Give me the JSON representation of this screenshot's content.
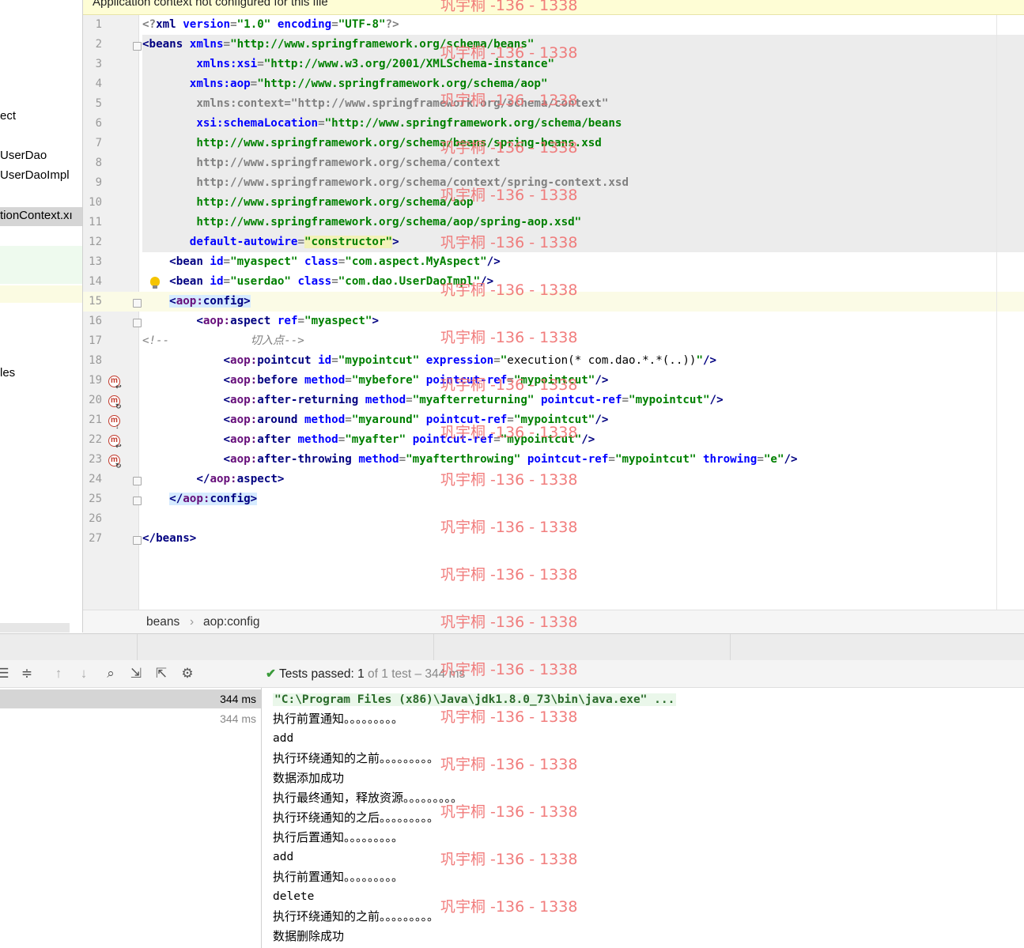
{
  "left_panel": {
    "items": [
      {
        "label": "ect"
      },
      {
        "label": "UserDao"
      },
      {
        "label": "UserDaoImpl"
      },
      {
        "label": "tionContext.xı"
      },
      {
        "label": "les"
      }
    ]
  },
  "editor": {
    "banner": "Application context not configured for this file",
    "line_numbers": [
      "1",
      "2",
      "3",
      "4",
      "5",
      "6",
      "7",
      "8",
      "9",
      "10",
      "11",
      "12",
      "13",
      "14",
      "15",
      "16",
      "17",
      "18",
      "19",
      "20",
      "21",
      "22",
      "23",
      "24",
      "25",
      "26",
      "27"
    ],
    "gutter_icon_letter": "m"
  },
  "breadcrumb": {
    "items": [
      "beans",
      "aop:config"
    ],
    "separator": "›"
  },
  "run": {
    "toolbar_icons": [
      "collapse-all-icon",
      "expand-all-icon",
      "up-arrow-icon",
      "down-arrow-icon",
      "history-icon",
      "import-icon",
      "export-icon",
      "settings-icon"
    ],
    "status_label": "Tests passed:",
    "status_count": "1",
    "status_detail": "of 1 test – 344 ms",
    "tree_rows": [
      {
        "time": "344 ms"
      },
      {
        "time": "344 ms"
      }
    ],
    "console_lines": [
      "\"C:\\Program Files (x86)\\Java\\jdk1.8.0_73\\bin\\java.exe\" ...",
      "执行前置通知。。。。。。。。。",
      "add",
      "执行环绕通知的之前。。。。。。。。。",
      "数据添加成功",
      "执行最终通知，释放资源。。。。。。。。。",
      "执行环绕通知的之后。。。。。。。。。",
      "执行后置通知。。。。。。。。。",
      "add",
      "执行前置通知。。。。。。。。。",
      "delete",
      "执行环绕通知的之前。。。。。。。。。",
      "数据删除成功"
    ]
  },
  "watermark": "巩宇桐 -136 - 1338",
  "colors": {
    "tag": "#000080",
    "attribute": "#0000ff",
    "value": "#008000",
    "watermark": "#f07070",
    "pass_check": "#3a9a3a"
  }
}
